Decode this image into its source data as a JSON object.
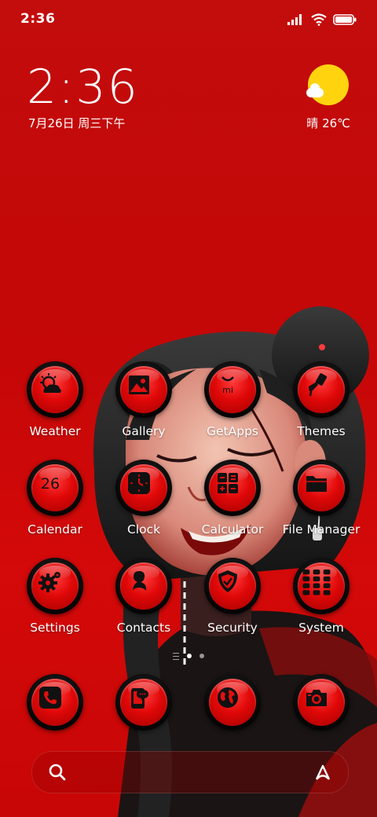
{
  "status_bar": {
    "time": "2:36",
    "icons": [
      "signal-icon",
      "wifi-icon",
      "battery-icon"
    ]
  },
  "clock_widget": {
    "time": "2:36",
    "date": "7月26日 周三下午"
  },
  "weather_widget": {
    "condition_icon": "sun-cloud-icon",
    "text": "晴 26℃"
  },
  "apps": [
    {
      "label": "Weather",
      "icon": "weather-icon"
    },
    {
      "label": "Gallery",
      "icon": "gallery-icon"
    },
    {
      "label": "GetApps",
      "icon": "getapps-bag-icon",
      "glyph": "mi"
    },
    {
      "label": "Themes",
      "icon": "paintbrush-icon"
    },
    {
      "label": "Calendar",
      "icon": "calendar-icon",
      "glyph": "26"
    },
    {
      "label": "Clock",
      "icon": "clock-icon"
    },
    {
      "label": "Calculator",
      "icon": "calculator-icon"
    },
    {
      "label": "File Manager",
      "icon": "folder-icon"
    },
    {
      "label": "Settings",
      "icon": "gear-icon"
    },
    {
      "label": "Contacts",
      "icon": "contact-icon"
    },
    {
      "label": "Security",
      "icon": "shield-icon"
    },
    {
      "label": "System",
      "icon": "system-grid-icon"
    }
  ],
  "dock": [
    {
      "icon": "phone-icon"
    },
    {
      "icon": "messages-phone-icon"
    },
    {
      "icon": "browser-globe-icon"
    },
    {
      "icon": "camera-icon"
    }
  ],
  "page_indicator": {
    "pages": 2,
    "active": 1
  },
  "search_bar": {
    "left_icon": "search-icon",
    "right_icon": "assistant-icon"
  },
  "colors": {
    "accent": "#d60909",
    "icon_ring": "#0a0a0a",
    "sun": "#ffd40f"
  }
}
